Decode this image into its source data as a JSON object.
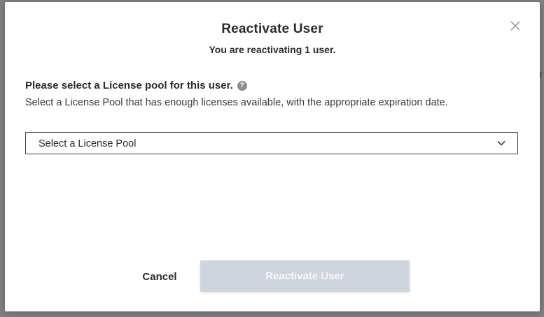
{
  "background": {
    "edge_text": "t"
  },
  "dialog": {
    "title": "Reactivate User",
    "subtitle": "You are reactivating 1 user.",
    "close_icon": "close-icon",
    "prompt": "Please select a License pool for this user.",
    "help_icon_glyph": "?",
    "hint": "Select a License Pool that has enough licenses available, with the appropriate expiration date.",
    "license_pool_select": {
      "value": "Select a License Pool",
      "icon": "chevron-down-icon"
    },
    "buttons": {
      "cancel": "Cancel",
      "reactivate": "Reactivate User",
      "reactivate_enabled": false
    }
  },
  "colors": {
    "overlay": "#7f8082",
    "modal_bg": "#ffffff",
    "text_primary": "#2a2b2e",
    "help_icon_bg": "#8a8d92",
    "disabled_button_bg": "#d0d4dc",
    "disabled_button_text": "#f6f7f9"
  }
}
